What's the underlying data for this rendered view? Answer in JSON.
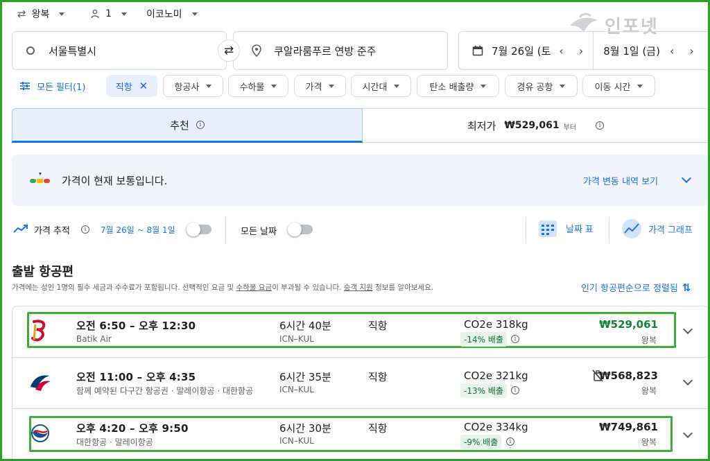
{
  "top_bar": {
    "trip_type": "왕복",
    "passengers": "1",
    "cabin_class": "이코노미"
  },
  "watermark": "인포넷",
  "search": {
    "origin": "서울특별시",
    "destination": "쿠알라룸푸르 연방 준주",
    "depart_date": "7월 26일 (토",
    "return_date": "8월 1일 (금)"
  },
  "filters": {
    "all_filters": "모든 필터(1)",
    "chips": [
      "직항",
      "항공사",
      "수하물",
      "가격",
      "시간대",
      "탄소 배출량",
      "경유 공항",
      "이동 시간"
    ]
  },
  "sort_tabs": {
    "recommended": "추천",
    "cheapest_label": "최저가",
    "cheapest_price": "₩529,061",
    "cheapest_suffix": "부터"
  },
  "price_insight": {
    "message": "가격이 현재 보통입니다.",
    "history_link": "가격 변동 내역 보기"
  },
  "tracking": {
    "track_label": "가격 추적",
    "dates": "7월 26일 ~ 8월 1일",
    "any_dates": "모든 날짜",
    "date_grid": "날짜 표",
    "price_graph": "가격 그래프"
  },
  "results": {
    "heading": "출발 항공편",
    "notice_1": "가격에는 성인 1명의 필수 세금과 수수료가 포함됩니다. 선택적인 요금 및 ",
    "notice_link_1": "수하물 요금",
    "notice_2": "이 부과될 수 있습니다. ",
    "notice_link_2": "승객 지원",
    "notice_3": " 정보를 알아보세요.",
    "sort_label": "인기 항공편순으로 정렬됨"
  },
  "flights": [
    {
      "times": "오전 6:50 – 오후 12:30",
      "airline": "Batik Air",
      "duration": "6시간 40분",
      "route": "ICN–KUL",
      "stops": "직항",
      "co2": "CO2e 318kg",
      "co2_diff": "-14% 배출",
      "price": "₩529,061",
      "trip": "왕복"
    },
    {
      "times": "오전 11:00 – 오후 4:35",
      "airline": "함께 예약된 다구간 항공권 · 말레이항공 · 대한항공",
      "duration": "6시간 35분",
      "route": "ICN–KUL",
      "stops": "직항",
      "co2": "CO2e 321kg",
      "co2_diff": "-13% 배출",
      "price": "₩568,823",
      "trip": "왕복"
    },
    {
      "times": "오후 4:20 – 오후 9:50",
      "airline": "대한항공 · 말레이항공",
      "duration": "6시간 30분",
      "route": "ICN–KUL",
      "stops": "직항",
      "co2": "CO2e 334kg",
      "co2_diff": "-9% 배출",
      "price": "₩749,861",
      "trip": "왕복"
    }
  ],
  "colors": {
    "accent": "#1a73e8",
    "highlight": "#3fae3a",
    "price_green": "#188038",
    "tab_bg": "#e8f0fe"
  }
}
